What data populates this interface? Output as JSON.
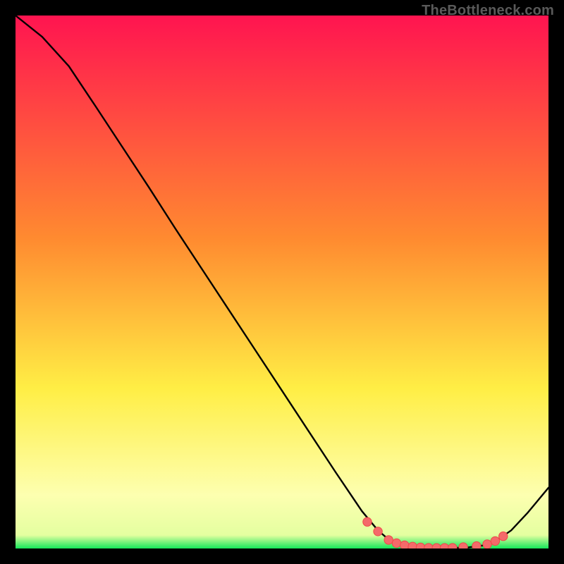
{
  "watermark": "TheBottleneck.com",
  "colors": {
    "bg": "#000000",
    "watermark": "#5a5a5a",
    "gradient_top": "#ff1450",
    "gradient_orange": "#ff8b30",
    "gradient_yellow": "#ffee45",
    "gradient_paleyellow": "#fdffb0",
    "gradient_green": "#15e85a",
    "line": "#000000",
    "dot_fill": "#f46a6a",
    "dot_stroke": "#ef4848"
  },
  "chart_data": {
    "type": "line",
    "title": "",
    "xlabel": "",
    "ylabel": "",
    "xlim": [
      0,
      100
    ],
    "ylim": [
      0,
      100
    ],
    "grid": false,
    "legend": false,
    "series": [
      {
        "name": "curve",
        "x": [
          0,
          5,
          10,
          15,
          20,
          25,
          30,
          35,
          40,
          45,
          50,
          55,
          60,
          65,
          68,
          70,
          73,
          76,
          79,
          82,
          85,
          88,
          90,
          93,
          96,
          100
        ],
        "y": [
          100,
          96,
          90.5,
          83,
          75.4,
          67.8,
          60,
          52.4,
          44.8,
          37.2,
          29.6,
          22,
          14.4,
          7,
          3.4,
          1.7,
          0.6,
          0.2,
          0.1,
          0.1,
          0.2,
          0.6,
          1.3,
          3.4,
          6.6,
          11.4
        ]
      }
    ],
    "highlighted_points": {
      "x": [
        66,
        68,
        70,
        71.5,
        73,
        74.5,
        76,
        77.5,
        79,
        80.5,
        82,
        84,
        86.5,
        88.5,
        90,
        91.5
      ],
      "y": [
        5.0,
        3.2,
        1.6,
        1.0,
        0.6,
        0.35,
        0.2,
        0.12,
        0.1,
        0.1,
        0.12,
        0.25,
        0.45,
        0.8,
        1.4,
        2.3
      ]
    }
  }
}
